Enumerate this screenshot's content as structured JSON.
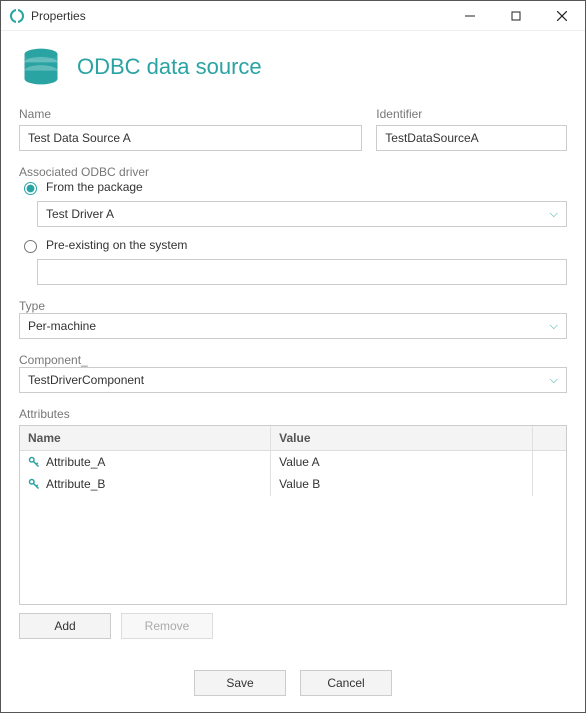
{
  "window": {
    "title": "Properties"
  },
  "page": {
    "title": "ODBC data source"
  },
  "labels": {
    "name": "Name",
    "identifier": "Identifier",
    "driver_group": "Associated ODBC driver",
    "from_package": "From the package",
    "preexisting": "Pre-existing on the system",
    "type": "Type",
    "component": "Component_",
    "attributes": "Attributes",
    "col_name": "Name",
    "col_value": "Value"
  },
  "fields": {
    "name": "Test Data Source A",
    "identifier": "TestDataSourceA",
    "package_driver": "Test Driver A",
    "preexisting_driver": "",
    "type": "Per-machine",
    "component": "TestDriverComponent"
  },
  "driver_mode": "package",
  "attributes": [
    {
      "name": "Attribute_A",
      "value": "Value A"
    },
    {
      "name": "Attribute_B",
      "value": "Value B"
    }
  ],
  "buttons": {
    "add": "Add",
    "remove": "Remove",
    "save": "Save",
    "cancel": "Cancel"
  }
}
